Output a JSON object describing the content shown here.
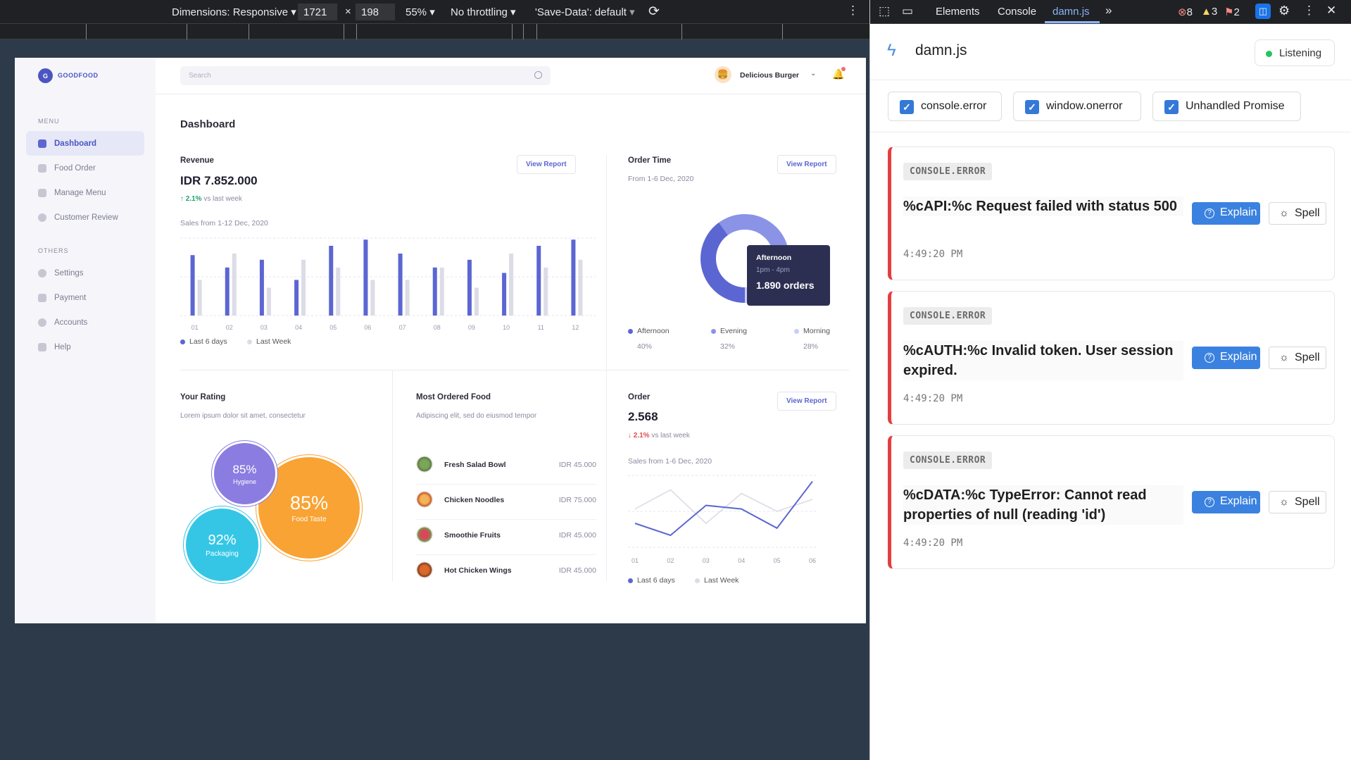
{
  "device_toolbar": {
    "dimensions_label": "Dimensions: Responsive",
    "width": "1721",
    "x_sep": "×",
    "height": "198",
    "zoom": "55%",
    "throttling": "No throttling",
    "save_data": "'Save-Data': default"
  },
  "devtools_tabs": {
    "elements": "Elements",
    "console": "Console",
    "damnjs": "damn.js",
    "errors": "8",
    "warnings": "3",
    "issues": "2"
  },
  "app": {
    "brand": "GOODFOOD",
    "brand_initial": "G",
    "menu_heading": "MENU",
    "others_heading": "OTHERS",
    "menu": [
      "Dashboard",
      "Food Order",
      "Manage Menu",
      "Customer Review"
    ],
    "others": [
      "Settings",
      "Payment",
      "Accounts",
      "Help"
    ],
    "search_placeholder": "Search",
    "restaurant": "Delicious Burger",
    "page_title": "Dashboard",
    "revenue": {
      "title": "Revenue",
      "value": "IDR 7.852.000",
      "change": "2.1%",
      "change_suffix": "vs last week",
      "range": "Sales from 1-12 Dec, 2020",
      "button": "View Report",
      "legend_a": "Last 6 days",
      "legend_b": "Last Week"
    },
    "order_time": {
      "title": "Order Time",
      "range": "From 1-6 Dec, 2020",
      "button": "View Report",
      "tooltip_title": "Afternoon",
      "tooltip_time": "1pm - 4pm",
      "tooltip_value": "1.890 orders",
      "legend": [
        {
          "name": "Afternoon",
          "pct": "40%",
          "color": "#5c66d2"
        },
        {
          "name": "Evening",
          "pct": "32%",
          "color": "#8a93e6"
        },
        {
          "name": "Morning",
          "pct": "28%",
          "color": "#c9cdf6"
        }
      ]
    },
    "rating": {
      "title": "Your Rating",
      "subtitle": "Lorem ipsum dolor sit amet, consectetur",
      "hygiene_pct": "85%",
      "hygiene": "Hygiene",
      "taste_pct": "85%",
      "taste": "Food Taste",
      "pack_pct": "92%",
      "pack": "Packaging"
    },
    "most_ordered": {
      "title": "Most Ordered Food",
      "subtitle": "Adipiscing elit, sed do eiusmod tempor",
      "items": [
        {
          "name": "Fresh Salad Bowl",
          "price": "IDR 45.000"
        },
        {
          "name": "Chicken Noodles",
          "price": "IDR 75.000"
        },
        {
          "name": "Smoothie Fruits",
          "price": "IDR 45.000"
        },
        {
          "name": "Hot Chicken Wings",
          "price": "IDR 45.000"
        }
      ]
    },
    "order": {
      "title": "Order",
      "value": "2.568",
      "change": "2.1%",
      "change_suffix": "vs last week",
      "range": "Sales from 1-6 Dec, 2020",
      "button": "View Report",
      "legend_a": "Last 6 days",
      "legend_b": "Last Week"
    }
  },
  "chart_data": [
    {
      "type": "bar",
      "categories": [
        "01",
        "02",
        "03",
        "04",
        "05",
        "06",
        "07",
        "08",
        "09",
        "10",
        "11",
        "12"
      ],
      "series": [
        {
          "name": "Last 6 days",
          "values": [
            78,
            62,
            72,
            46,
            90,
            98,
            80,
            62,
            72,
            55,
            90,
            98
          ]
        },
        {
          "name": "Last Week",
          "values": [
            46,
            80,
            36,
            72,
            62,
            46,
            46,
            62,
            36,
            80,
            62,
            72
          ]
        }
      ],
      "ylim": [
        0,
        100
      ],
      "grid": true,
      "legend": "bottom-left",
      "colors": [
        "#5c66d2",
        "#dcdce6"
      ]
    },
    {
      "type": "pie",
      "categories": [
        "Afternoon",
        "Evening",
        "Morning"
      ],
      "values": [
        40,
        32,
        28
      ],
      "colors": [
        "#5c66d2",
        "#8a93e6",
        "#c9cdf6"
      ],
      "legend": "bottom"
    },
    {
      "type": "line",
      "categories": [
        "01",
        "02",
        "03",
        "04",
        "05",
        "06"
      ],
      "series": [
        {
          "name": "Last 6 days",
          "values": [
            40,
            30,
            55,
            52,
            36,
            75
          ]
        },
        {
          "name": "Last Week",
          "values": [
            52,
            68,
            40,
            65,
            50,
            60
          ]
        }
      ],
      "ylim": [
        20,
        80
      ],
      "grid": true,
      "legend": "bottom-left",
      "colors": [
        "#5c66d2",
        "#dcdce6"
      ]
    }
  ],
  "panel": {
    "title": "damn.js",
    "status": "Listening",
    "filters": [
      "console.error",
      "window.onerror",
      "Unhandled Promise"
    ],
    "explain": "Explain",
    "spell": "Spell",
    "errors": [
      {
        "type": "CONSOLE.ERROR",
        "message": "%cAPI:%c Request failed with status 500",
        "time": "4:49:20 PM"
      },
      {
        "type": "CONSOLE.ERROR",
        "message": "%cAUTH:%c Invalid token. User session expired.",
        "time": "4:49:20 PM"
      },
      {
        "type": "CONSOLE.ERROR",
        "message": "%cDATA:%c TypeError: Cannot read properties of null (reading 'id')",
        "time": "4:49:20 PM"
      }
    ]
  }
}
